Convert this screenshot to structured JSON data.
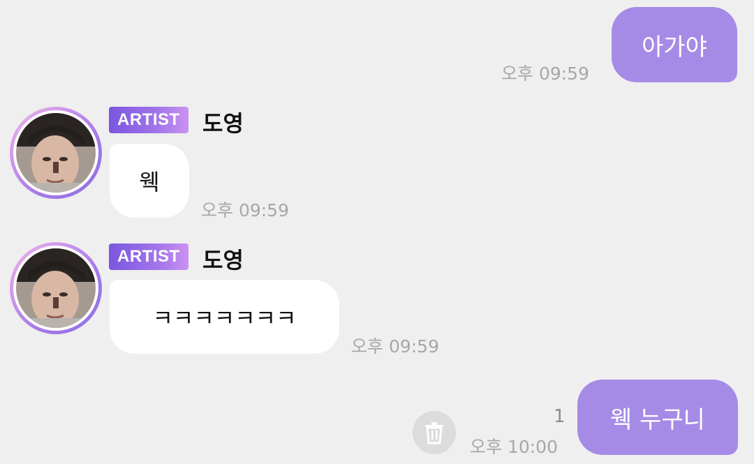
{
  "messages": {
    "m1": {
      "text": "아가야",
      "time": "오후 09:59"
    },
    "m2": {
      "badge": "ARTIST",
      "sender": "도영",
      "text": "웩",
      "time": "오후 09:59"
    },
    "m3": {
      "badge": "ARTIST",
      "sender": "도영",
      "text": "ㅋㅋㅋㅋㅋㅋㅋ",
      "time": "오후 09:59"
    },
    "m4": {
      "text": "웩 누구니",
      "time": "오후 10:00",
      "unread": "1"
    }
  },
  "icons": {
    "avatar": "artist-avatar",
    "delete": "trash-icon"
  },
  "colors": {
    "outgoing_bubble": "#a68be6",
    "incoming_bubble": "#ffffff",
    "background": "#efefef",
    "badge_start": "#7a56e0",
    "badge_end": "#cb92f1"
  }
}
